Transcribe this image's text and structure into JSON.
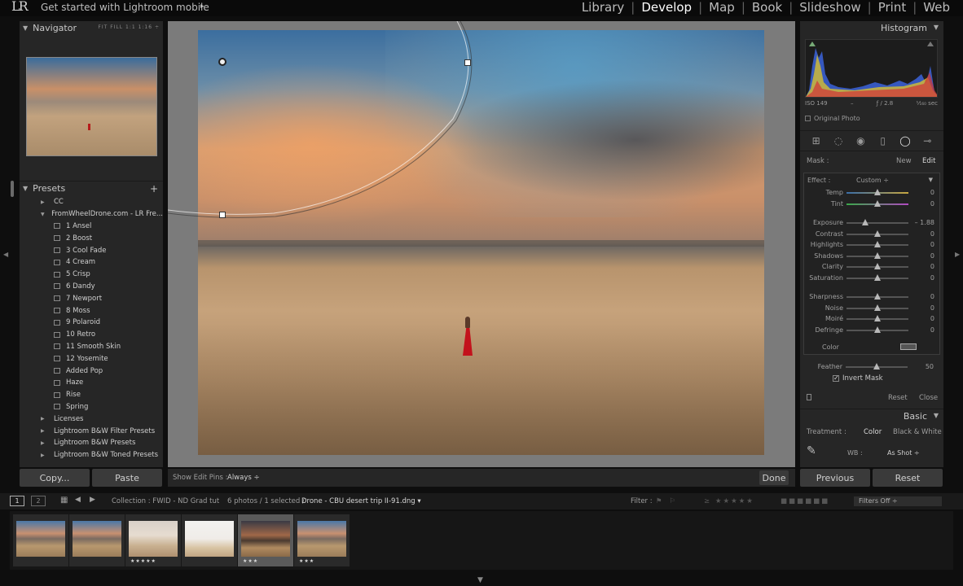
{
  "topbar": {
    "logo": "LR",
    "mobile_link": "Get started with Lightroom mobile",
    "mobile_arrow": "▸",
    "modules": [
      {
        "label": "Library",
        "active": false
      },
      {
        "label": "Develop",
        "active": true
      },
      {
        "label": "Map",
        "active": false
      },
      {
        "label": "Book",
        "active": false
      },
      {
        "label": "Slideshow",
        "active": false
      },
      {
        "label": "Print",
        "active": false
      },
      {
        "label": "Web",
        "active": false
      }
    ]
  },
  "navigator": {
    "title": "Navigator",
    "zoom_options": "FIT  FILL  1:1  1:16 ÷"
  },
  "presets": {
    "title": "Presets",
    "add": "+",
    "items": [
      {
        "label": "CC",
        "level": 0,
        "type": "folder",
        "open": false
      },
      {
        "label": "FromWheelDrone.com - LR Fre...",
        "level": 0,
        "type": "folder",
        "open": true
      },
      {
        "label": "1 Ansel",
        "level": 1,
        "type": "preset"
      },
      {
        "label": "2 Boost",
        "level": 1,
        "type": "preset"
      },
      {
        "label": "3 Cool Fade",
        "level": 1,
        "type": "preset"
      },
      {
        "label": "4 Cream",
        "level": 1,
        "type": "preset"
      },
      {
        "label": "5 Crisp",
        "level": 1,
        "type": "preset"
      },
      {
        "label": "6 Dandy",
        "level": 1,
        "type": "preset"
      },
      {
        "label": "7 Newport",
        "level": 1,
        "type": "preset"
      },
      {
        "label": "8 Moss",
        "level": 1,
        "type": "preset"
      },
      {
        "label": "9 Polaroid",
        "level": 1,
        "type": "preset"
      },
      {
        "label": "10 Retro",
        "level": 1,
        "type": "preset"
      },
      {
        "label": "11 Smooth Skin",
        "level": 1,
        "type": "preset"
      },
      {
        "label": "12 Yosemite",
        "level": 1,
        "type": "preset"
      },
      {
        "label": "Added Pop",
        "level": 1,
        "type": "preset"
      },
      {
        "label": "Haze",
        "level": 1,
        "type": "preset"
      },
      {
        "label": "Rise",
        "level": 1,
        "type": "preset"
      },
      {
        "label": "Spring",
        "level": 1,
        "type": "preset"
      },
      {
        "label": "Licenses",
        "level": 0,
        "type": "folder",
        "open": false
      },
      {
        "label": "Lightroom B&W Filter Presets",
        "level": 0,
        "type": "folder",
        "open": false
      },
      {
        "label": "Lightroom B&W Presets",
        "level": 0,
        "type": "folder",
        "open": false
      },
      {
        "label": "Lightroom B&W Toned Presets",
        "level": 0,
        "type": "folder",
        "open": false
      }
    ]
  },
  "left_buttons": {
    "copy": "Copy...",
    "paste": "Paste"
  },
  "center_toolbar": {
    "edit_pins_label": "Show Edit Pins :",
    "edit_pins_value": "Always ÷",
    "done": "Done"
  },
  "histogram": {
    "title": "Histogram",
    "iso": "ISO 149",
    "focal": "–",
    "aperture": "ƒ / 2.8",
    "shutter": "¹⁄₁₆₀ sec",
    "original_photo": "Original Photo"
  },
  "mask": {
    "label": "Mask :",
    "new": "New",
    "edit": "Edit",
    "effect_label": "Effect :",
    "effect_value": "Custom ÷",
    "sliders": [
      {
        "label": "Temp",
        "value": "0",
        "position": 0.5,
        "track": "temp",
        "group": 0
      },
      {
        "label": "Tint",
        "value": "0",
        "position": 0.5,
        "track": "tint",
        "group": 0
      },
      {
        "label": "Exposure",
        "value": "– 1.88",
        "position": 0.3,
        "track": "plain",
        "group": 1
      },
      {
        "label": "Contrast",
        "value": "0",
        "position": 0.5,
        "track": "plain",
        "group": 1
      },
      {
        "label": "Highlights",
        "value": "0",
        "position": 0.5,
        "track": "plain",
        "group": 1
      },
      {
        "label": "Shadows",
        "value": "0",
        "position": 0.5,
        "track": "plain",
        "group": 1
      },
      {
        "label": "Clarity",
        "value": "0",
        "position": 0.5,
        "track": "plain",
        "group": 1
      },
      {
        "label": "Saturation",
        "value": "0",
        "position": 0.5,
        "track": "plain",
        "group": 1
      },
      {
        "label": "Sharpness",
        "value": "0",
        "position": 0.5,
        "track": "plain",
        "group": 2
      },
      {
        "label": "Noise",
        "value": "0",
        "position": 0.5,
        "track": "plain",
        "group": 2
      },
      {
        "label": "Moiré",
        "value": "0",
        "position": 0.5,
        "track": "plain",
        "group": 2
      },
      {
        "label": "Defringe",
        "value": "0",
        "position": 0.5,
        "track": "plain",
        "group": 2
      }
    ],
    "color_label": "Color",
    "feather_label": "Feather",
    "feather_value": "50",
    "feather_position": 0.5,
    "invert_label": "Invert Mask",
    "invert_checked": true,
    "reset": "Reset",
    "close": "Close"
  },
  "basic": {
    "title": "Basic",
    "treatment_label": "Treatment :",
    "treatment_color": "Color",
    "treatment_bw": "Black & White",
    "wb_label": "WB :",
    "wb_value": "As Shot ÷"
  },
  "right_buttons": {
    "previous": "Previous",
    "reset": "Reset"
  },
  "filmstrip_bar": {
    "page1": "1",
    "page2": "2",
    "collection": "Collection : FWID - ND Grad tut",
    "selection_count": "6 photos / 1 selected /",
    "filename": "Drone - CBU desert trip II-91.dng ▾",
    "filter_label": "Filter :",
    "filters_value": "Filters Off ÷"
  },
  "filmstrip": {
    "thumbs": [
      {
        "stars": "",
        "selected": false,
        "style": "sunset"
      },
      {
        "stars": "",
        "selected": false,
        "style": "sunset"
      },
      {
        "stars": "★★★★★",
        "selected": false,
        "style": "bright"
      },
      {
        "stars": "",
        "selected": false,
        "style": "white"
      },
      {
        "stars": "★★★",
        "selected": true,
        "style": "dark"
      },
      {
        "stars": "★★★",
        "selected": false,
        "style": "sunset"
      }
    ]
  },
  "colors": {
    "panel_bg": "#262626",
    "center_bg": "#7b7b7b",
    "dress_red": "#c3121c",
    "sky_blue": "#3b6e9f"
  }
}
